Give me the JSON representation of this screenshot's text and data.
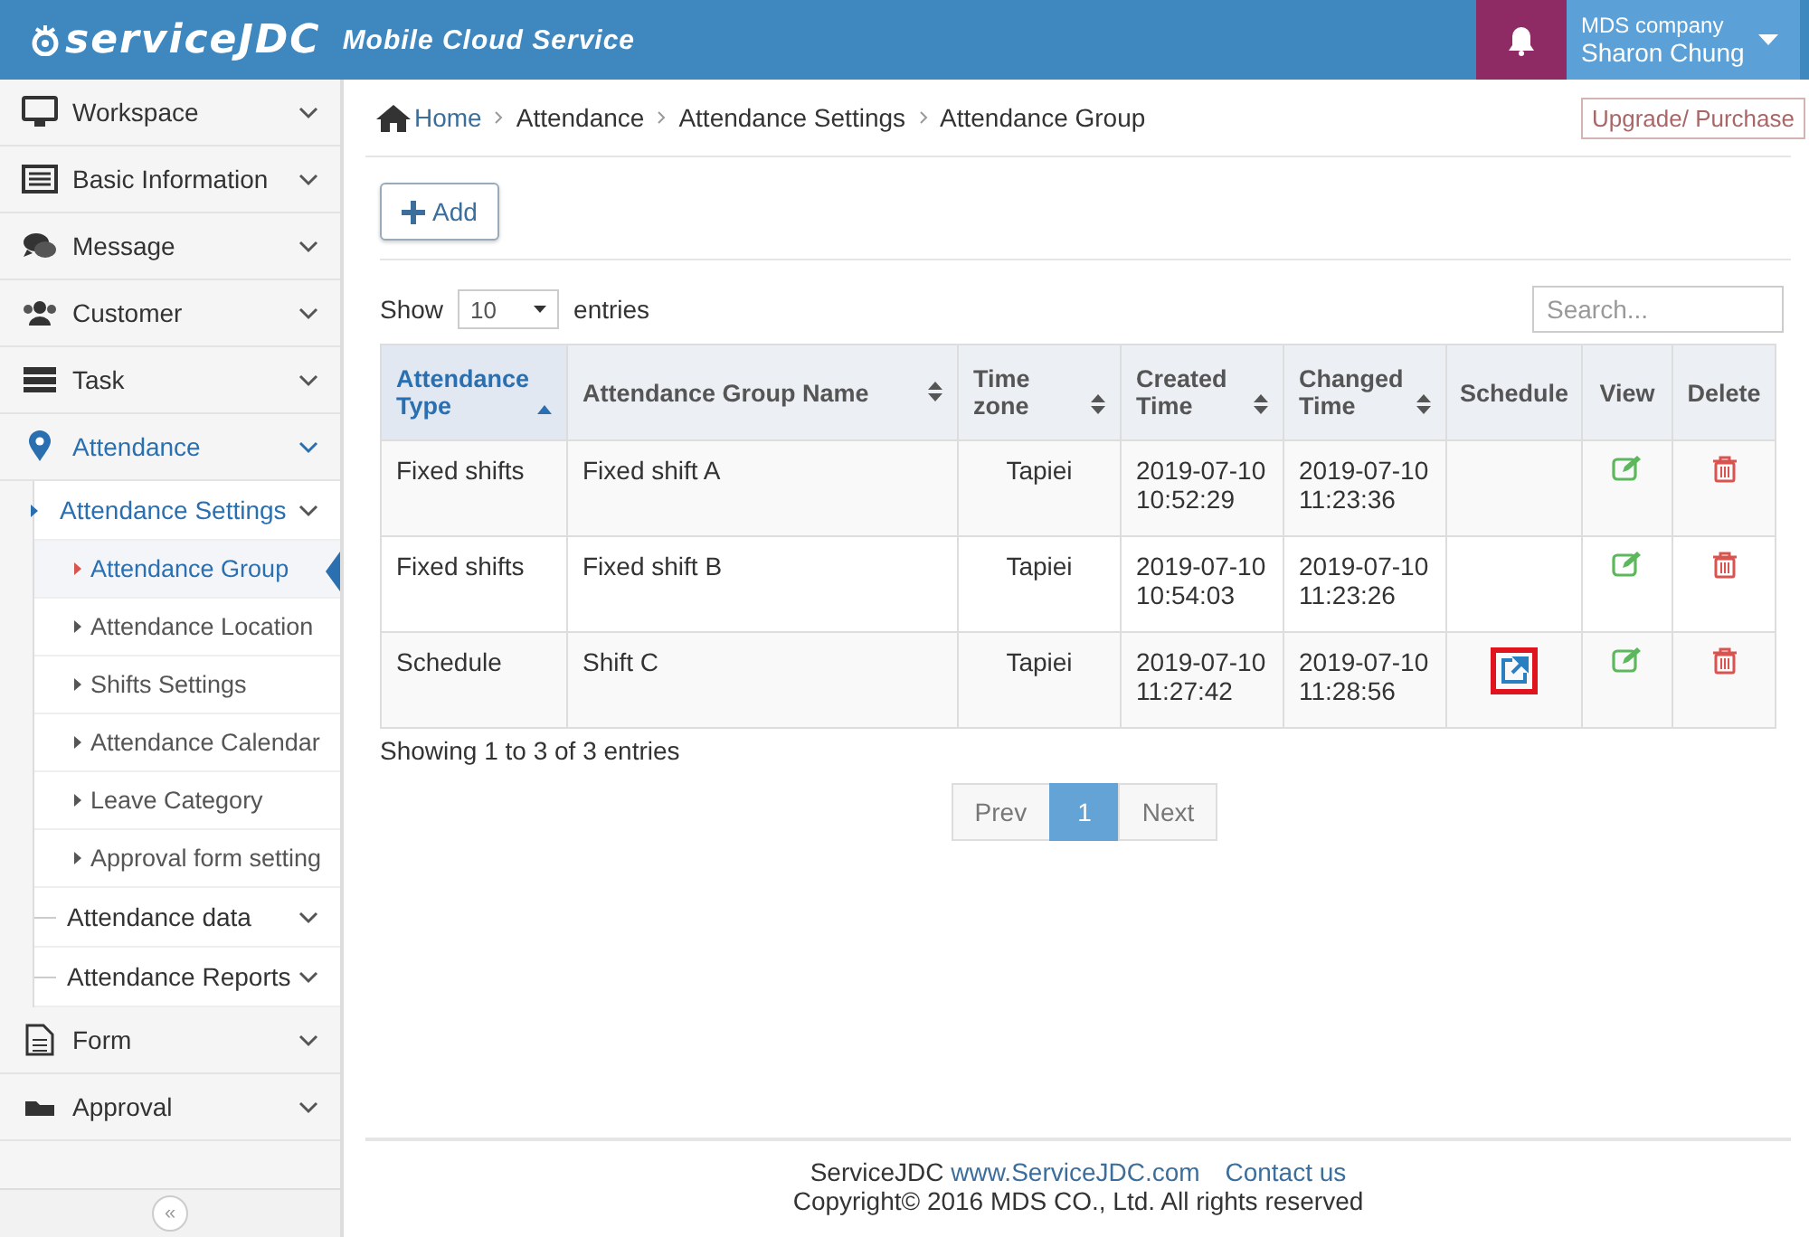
{
  "header": {
    "logo": "serviceJDC",
    "tagline": "Mobile Cloud Service",
    "company": "MDS company",
    "user": "Sharon Chung"
  },
  "sidebar": {
    "items": [
      {
        "label": "Workspace",
        "expanded": false,
        "selected": false
      },
      {
        "label": "Basic Information",
        "expanded": false,
        "selected": false
      },
      {
        "label": "Message",
        "expanded": false,
        "selected": false
      },
      {
        "label": "Customer",
        "expanded": false,
        "selected": false
      },
      {
        "label": "Task",
        "expanded": false,
        "selected": false
      },
      {
        "label": "Attendance",
        "expanded": true,
        "selected": true,
        "children": [
          {
            "label": "Attendance Settings",
            "expanded": true,
            "selected": true,
            "children": [
              {
                "label": "Attendance Group",
                "selected": true
              },
              {
                "label": "Attendance Location",
                "selected": false
              },
              {
                "label": "Shifts Settings",
                "selected": false
              },
              {
                "label": "Attendance Calendar",
                "selected": false
              },
              {
                "label": "Leave Category",
                "selected": false
              },
              {
                "label": "Approval form setting",
                "selected": false
              }
            ]
          },
          {
            "label": "Attendance data",
            "expanded": false,
            "selected": false
          },
          {
            "label": "Attendance Reports",
            "expanded": false,
            "selected": false
          }
        ]
      },
      {
        "label": "Form",
        "expanded": false,
        "selected": false
      },
      {
        "label": "Approval",
        "expanded": false,
        "selected": false
      }
    ],
    "collapse": "«"
  },
  "breadcrumb": [
    "Home",
    "Attendance",
    "Attendance Settings",
    "Attendance Group"
  ],
  "upgrade": "Upgrade/ Purchase",
  "add_button": "Add",
  "length": {
    "show": "Show",
    "value": "10",
    "entries": "entries"
  },
  "search": {
    "placeholder": "Search..."
  },
  "table": {
    "columns": [
      {
        "label": "Attendance Type",
        "sortable": true,
        "sorted": true
      },
      {
        "label": "Attendance Group Name",
        "sortable": true,
        "sorted": false
      },
      {
        "label": "Time zone",
        "sortable": true,
        "sorted": false
      },
      {
        "label": "Created Time",
        "sortable": true,
        "sorted": false
      },
      {
        "label": "Changed Time",
        "sortable": true,
        "sorted": false
      },
      {
        "label": "Schedule",
        "sortable": false,
        "sorted": false
      },
      {
        "label": "View",
        "sortable": false,
        "sorted": false
      },
      {
        "label": "Delete",
        "sortable": false,
        "sorted": false
      }
    ],
    "rows": [
      {
        "type": "Fixed shifts",
        "name": "Fixed shift A",
        "zone": "Tapiei",
        "created": [
          "2019-07-10",
          "10:52:29"
        ],
        "changed": [
          "2019-07-10",
          "11:23:36"
        ],
        "schedule_link": false
      },
      {
        "type": "Fixed shifts",
        "name": "Fixed shift B",
        "zone": "Tapiei",
        "created": [
          "2019-07-10",
          "10:54:03"
        ],
        "changed": [
          "2019-07-10",
          "11:23:26"
        ],
        "schedule_link": false
      },
      {
        "type": "Schedule",
        "name": "Shift C",
        "zone": "Tapiei",
        "created": [
          "2019-07-10",
          "11:27:42"
        ],
        "changed": [
          "2019-07-10",
          "11:28:56"
        ],
        "schedule_link": true,
        "highlighted": true
      }
    ]
  },
  "info": "Showing 1 to 3 of 3 entries",
  "pagination": [
    {
      "label": "Prev",
      "selected": false
    },
    {
      "label": "1",
      "selected": true
    },
    {
      "label": "Next",
      "selected": false
    }
  ],
  "footer": {
    "brand": "ServiceJDC",
    "site": "www.ServiceJDC.com",
    "contact": "Contact us",
    "copyright": "Copyright© 2016 MDS CO., Ltd. All rights reserved"
  }
}
